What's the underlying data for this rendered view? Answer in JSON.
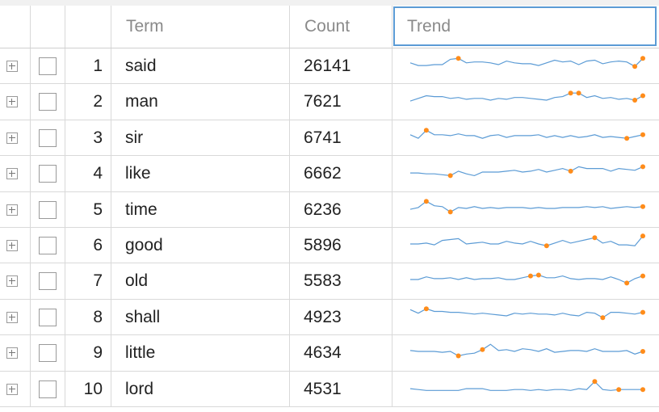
{
  "header": {
    "term": "Term",
    "count": "Count",
    "trend": "Trend"
  },
  "colors": {
    "spark_line": "#5b9bd5",
    "spark_marker": "#ff8c1a",
    "header_border": "#5b9bd5"
  },
  "rows": [
    {
      "index": "1",
      "term": "said",
      "count": "26141",
      "trend": [
        12,
        9,
        9,
        10,
        10,
        16,
        17,
        12,
        13,
        13,
        12,
        10,
        14,
        12,
        11,
        11,
        9,
        12,
        15,
        13,
        14,
        10,
        14,
        15,
        11,
        13,
        14,
        13,
        8,
        17
      ],
      "markers": [
        6,
        28,
        29
      ]
    },
    {
      "index": "2",
      "term": "man",
      "count": "7621",
      "trend": [
        9,
        12,
        15,
        14,
        14,
        12,
        13,
        11,
        12,
        12,
        10,
        12,
        11,
        13,
        13,
        12,
        11,
        10,
        13,
        14,
        18,
        18,
        13,
        15,
        12,
        13,
        11,
        12,
        10,
        15
      ],
      "markers": [
        20,
        21,
        28,
        29
      ]
    },
    {
      "index": "3",
      "term": "sir",
      "count": "6741",
      "trend": [
        12,
        8,
        17,
        12,
        12,
        11,
        13,
        11,
        11,
        8,
        11,
        12,
        9,
        11,
        11,
        11,
        12,
        9,
        11,
        9,
        11,
        9,
        10,
        12,
        9,
        10,
        9,
        8,
        10,
        12
      ],
      "markers": [
        2,
        27,
        29
      ]
    },
    {
      "index": "4",
      "term": "like",
      "count": "6662",
      "trend": [
        9,
        9,
        8,
        8,
        7,
        6,
        11,
        8,
        6,
        10,
        10,
        10,
        11,
        12,
        10,
        11,
        13,
        10,
        12,
        14,
        11,
        16,
        14,
        14,
        14,
        11,
        14,
        13,
        12,
        16
      ],
      "markers": [
        5,
        20,
        29
      ]
    },
    {
      "index": "5",
      "term": "time",
      "count": "6236",
      "trend": [
        9,
        11,
        18,
        13,
        12,
        6,
        11,
        10,
        12,
        10,
        11,
        10,
        11,
        11,
        11,
        10,
        11,
        10,
        10,
        11,
        11,
        11,
        12,
        11,
        12,
        10,
        11,
        12,
        11,
        12
      ],
      "markers": [
        2,
        5,
        29
      ]
    },
    {
      "index": "6",
      "term": "good",
      "count": "5896",
      "trend": [
        10,
        10,
        11,
        9,
        14,
        15,
        16,
        10,
        11,
        12,
        10,
        10,
        13,
        11,
        10,
        13,
        10,
        8,
        11,
        14,
        11,
        13,
        15,
        17,
        11,
        13,
        9,
        9,
        8,
        19
      ],
      "markers": [
        17,
        23,
        29
      ]
    },
    {
      "index": "7",
      "term": "old",
      "count": "5583",
      "trend": [
        10,
        10,
        13,
        11,
        11,
        12,
        10,
        12,
        10,
        11,
        11,
        12,
        10,
        10,
        12,
        14,
        15,
        12,
        12,
        14,
        11,
        10,
        11,
        11,
        10,
        13,
        10,
        6,
        11,
        14
      ],
      "markers": [
        15,
        16,
        27,
        29
      ]
    },
    {
      "index": "8",
      "term": "shall",
      "count": "4923",
      "trend": [
        17,
        13,
        18,
        15,
        15,
        14,
        14,
        13,
        12,
        13,
        12,
        11,
        10,
        13,
        12,
        13,
        12,
        12,
        11,
        13,
        11,
        10,
        14,
        13,
        8,
        14,
        14,
        13,
        12,
        14
      ],
      "markers": [
        2,
        24,
        29
      ]
    },
    {
      "index": "9",
      "term": "little",
      "count": "4634",
      "trend": [
        11,
        10,
        10,
        10,
        9,
        10,
        5,
        7,
        8,
        12,
        18,
        11,
        12,
        10,
        13,
        12,
        10,
        13,
        9,
        10,
        11,
        11,
        10,
        13,
        10,
        10,
        10,
        11,
        7,
        10
      ],
      "markers": [
        6,
        9,
        29
      ]
    },
    {
      "index": "10",
      "term": "lord",
      "count": "4531",
      "trend": [
        9,
        8,
        7,
        7,
        7,
        7,
        7,
        9,
        9,
        9,
        7,
        7,
        7,
        8,
        8,
        7,
        8,
        7,
        8,
        8,
        7,
        9,
        8,
        17,
        8,
        7,
        8,
        8,
        8,
        8
      ],
      "markers": [
        23,
        26,
        29
      ]
    }
  ]
}
